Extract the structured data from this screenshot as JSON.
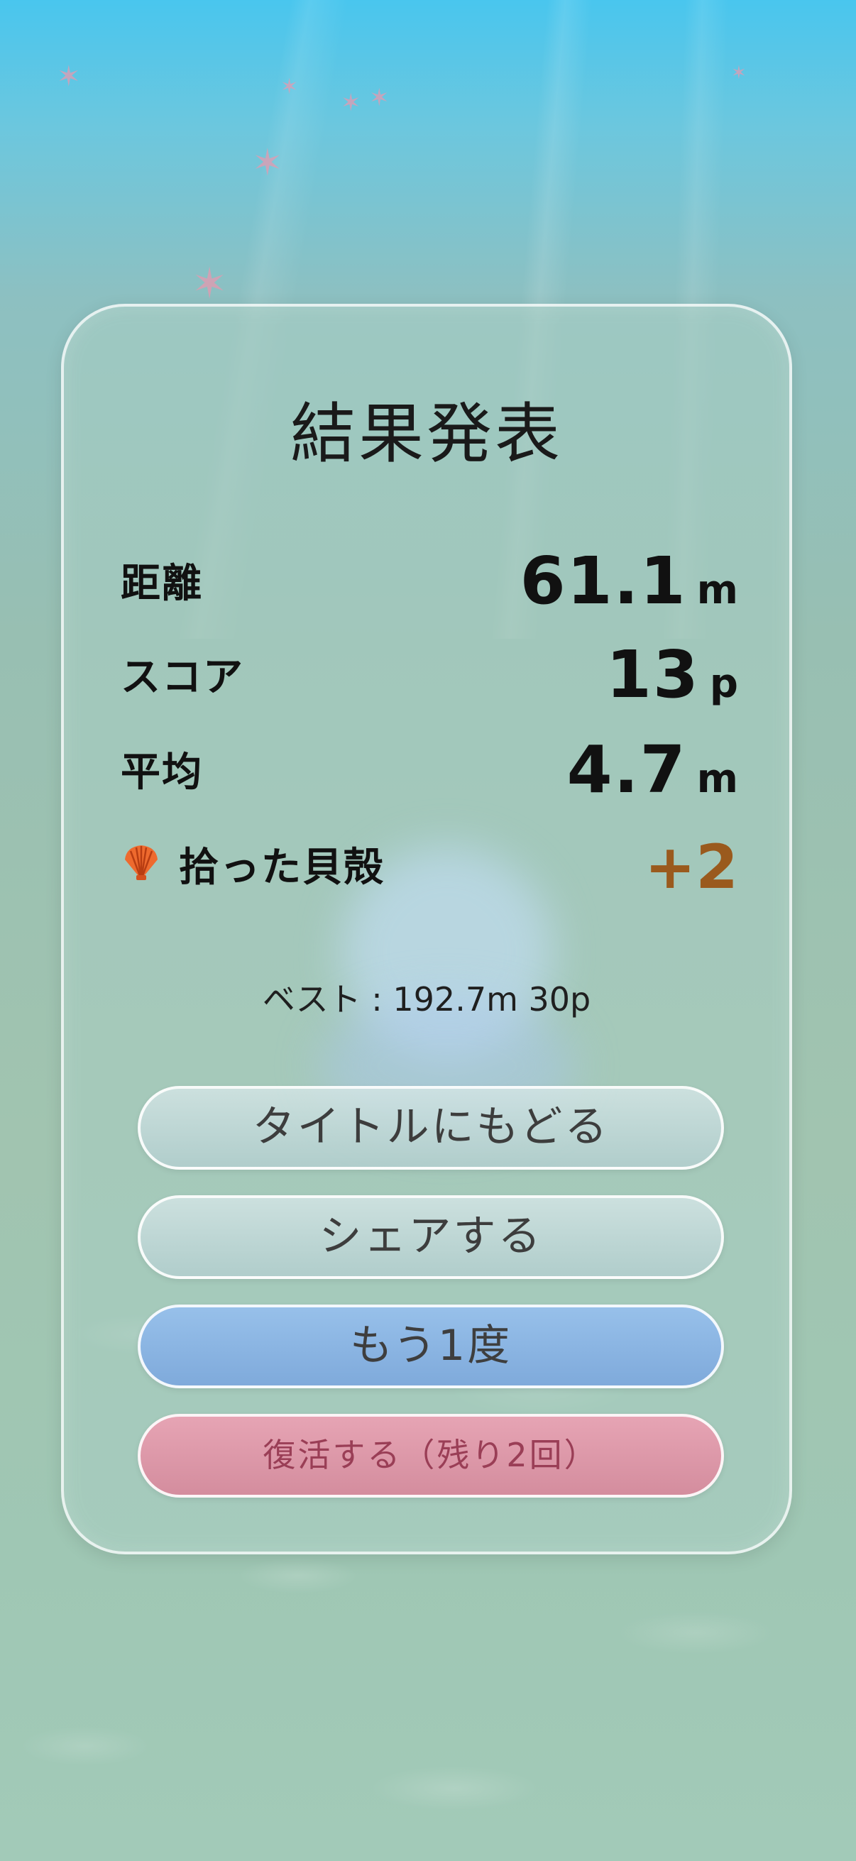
{
  "results": {
    "title": "結果発表",
    "distance": {
      "label": "距離",
      "value": "61.1",
      "unit": "m"
    },
    "score": {
      "label": "スコア",
      "value": "13",
      "unit": "p"
    },
    "average": {
      "label": "平均",
      "value": "4.7",
      "unit": "m"
    },
    "shells": {
      "label": "拾った貝殻",
      "value": "+2",
      "icon": "scallop-shell-icon"
    },
    "best": "ベスト : 192.7m 30p"
  },
  "buttons": {
    "back_to_title": "タイトルにもどる",
    "share": "シェアする",
    "retry": "もう1度",
    "revive": "復活する（残り2回）"
  },
  "colors": {
    "shell_bonus": "#9a5a1d",
    "retry_button": "#8db5e4",
    "revive_button": "#dc98a8"
  }
}
